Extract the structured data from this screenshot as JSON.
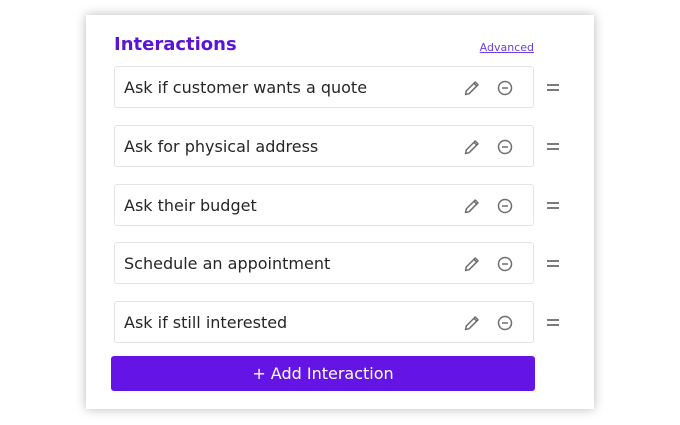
{
  "panel": {
    "title": "Interactions",
    "advanced_link": "Advanced"
  },
  "interactions": [
    {
      "label": "Ask if customer wants a quote",
      "edit_icon": "pencil-icon",
      "remove_icon": "minus-circle-icon",
      "drag_icon": "drag-handle-icon"
    },
    {
      "label": "Ask for physical address",
      "edit_icon": "pencil-icon",
      "remove_icon": "minus-circle-icon",
      "drag_icon": "drag-handle-icon"
    },
    {
      "label": "Ask their budget",
      "edit_icon": "pencil-icon",
      "remove_icon": "minus-circle-icon",
      "drag_icon": "drag-handle-icon"
    },
    {
      "label": "Schedule an appointment",
      "edit_icon": "pencil-icon",
      "remove_icon": "minus-circle-icon",
      "drag_icon": "drag-handle-icon"
    },
    {
      "label": "Ask if still interested",
      "edit_icon": "pencil-icon",
      "remove_icon": "minus-circle-icon",
      "drag_icon": "drag-handle-icon"
    }
  ],
  "add_button": {
    "label": "+ Add Interaction"
  },
  "colors": {
    "accent": "#6415e6",
    "title": "#5b14d6",
    "link": "#6b3fe0",
    "icon": "#6e6e6e"
  }
}
